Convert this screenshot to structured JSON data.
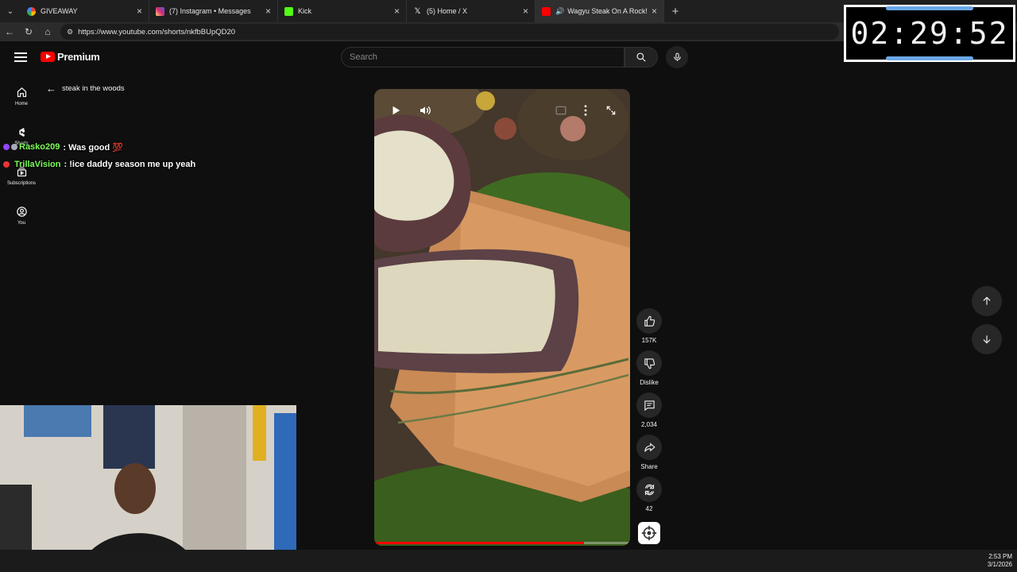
{
  "browser": {
    "tabs": [
      {
        "title": "GIVEAWAY",
        "favicon_color": "#4285f4"
      },
      {
        "title": "(7) Instagram • Messages",
        "favicon_color": "#d62976"
      },
      {
        "title": "Kick",
        "favicon_color": "#53fc18"
      },
      {
        "title": "(5) Home / X",
        "favicon_color": "#ffffff"
      },
      {
        "title": "Wagyu Steak On A Rock! wild",
        "favicon_color": "#ff0000",
        "active": true
      }
    ],
    "url": "https://www.youtube.com/shorts/nkfbBUpQD20"
  },
  "youtube": {
    "logo_text": "Premium",
    "search_placeholder": "Search",
    "guide": [
      {
        "label": "Home",
        "icon": "home-icon"
      },
      {
        "label": "Shorts",
        "icon": "shorts-icon"
      },
      {
        "label": "Subscriptions",
        "icon": "subscriptions-icon"
      },
      {
        "label": "You",
        "icon": "you-icon"
      }
    ],
    "back_label": "steak in the woods",
    "actions": {
      "like_count": "157K",
      "dislike_label": "Dislike",
      "comment_count": "2,034",
      "share_label": "Share",
      "remix_count": "42"
    },
    "progress": 0.82
  },
  "chat": [
    {
      "user": "Rasko209",
      "message": ": Was good 💯"
    },
    {
      "user": "TrillaVision",
      "message": ": !ice daddy season me up yeah"
    }
  ],
  "timer": {
    "time": "02:29:52"
  },
  "taskbar": {
    "time": "2:53 PM",
    "date": "3/1/2026"
  },
  "colors": {
    "accent": "#ff0000",
    "chat_user": "#7dff5a",
    "timer_bar": "#6aa8e8"
  }
}
